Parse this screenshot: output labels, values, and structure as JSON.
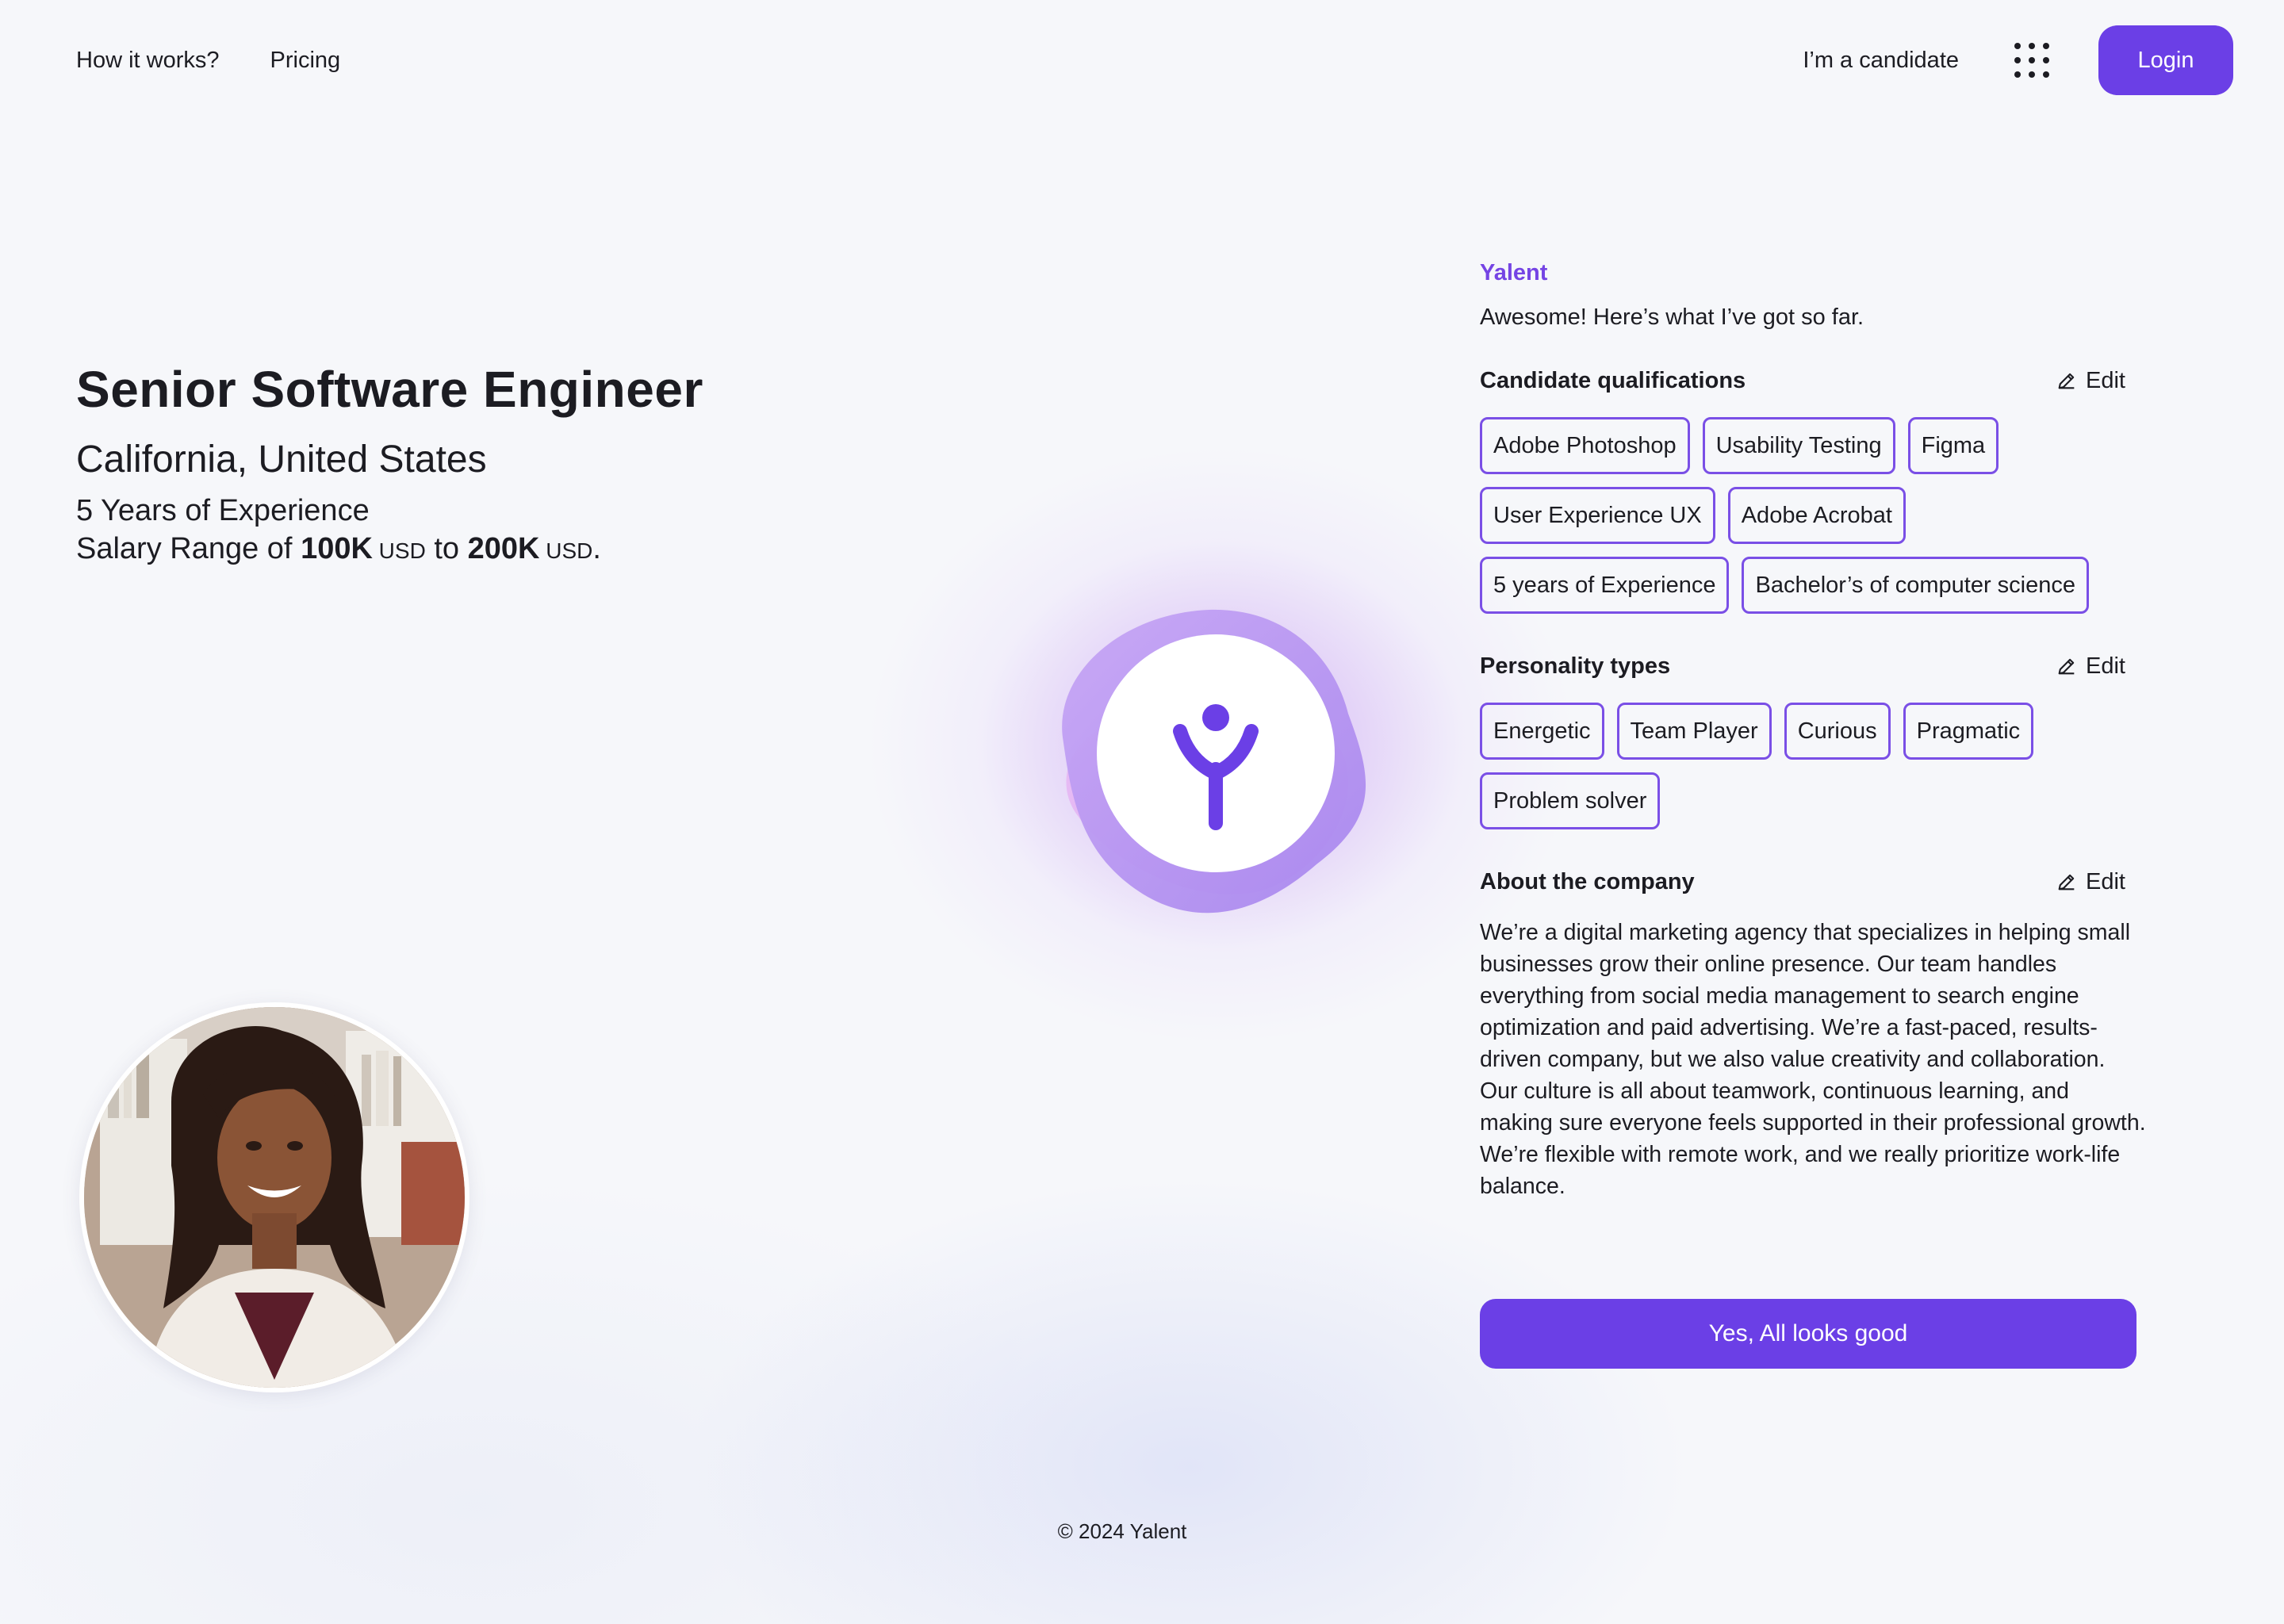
{
  "nav": {
    "links": [
      "How it works?",
      "Pricing"
    ],
    "candidate_link": "I’m a candidate",
    "apps_icon": "grid-dots-icon",
    "login_label": "Login"
  },
  "job": {
    "title": "Senior Software Engineer",
    "location": "California, United States",
    "experience": "5 Years of Experience",
    "salary_prefix": "Salary Range of ",
    "salary_min": "100K",
    "salary_min_unit": " USD",
    "salary_mid": " to ",
    "salary_max": "200K",
    "salary_max_unit": " USD",
    "salary_suffix": "."
  },
  "assistant": {
    "name": "Yalent",
    "message": "Awesome! Here’s what I’ve got so far."
  },
  "qualifications": {
    "title": "Candidate qualifications",
    "edit_label": "Edit",
    "items": [
      "Adobe Photoshop",
      "Usability Testing",
      "Figma",
      "User Experience UX",
      "Adobe Acrobat",
      "5 years of Experience",
      "Bachelor’s of computer science"
    ]
  },
  "personality": {
    "title": "Personality types",
    "edit_label": "Edit",
    "items": [
      "Energetic",
      "Team Player",
      "Curious",
      "Pragmatic",
      "Problem solver"
    ]
  },
  "about": {
    "title": "About the company",
    "edit_label": "Edit",
    "text": "We’re a digital marketing agency that specializes in helping small businesses grow their online presence. Our team handles everything from social media management to search engine optimization and paid advertising. We’re a fast-paced, results-driven company, but we also value creativity and collaboration. Our culture is all about teamwork, continuous learning, and making sure everyone feels supported in their professional growth. We’re flexible with remote work, and we really prioritize work-life balance."
  },
  "confirm_label": "Yes, All looks good",
  "footer": "© 2024 Yalent",
  "colors": {
    "brand": "#6b3fe6",
    "chip_border": "#7a4fe6",
    "accent_text": "#7544e4",
    "background": "#f6f7fa"
  }
}
